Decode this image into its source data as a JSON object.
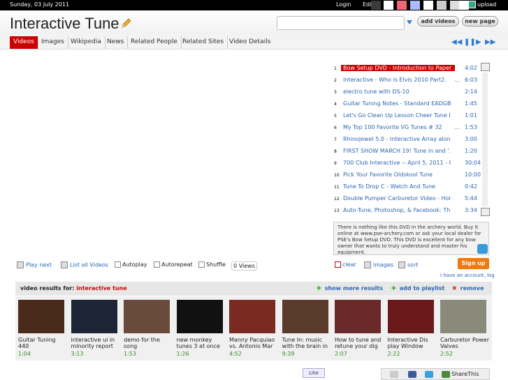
{
  "topbar": {
    "date": "Sunday, 03 July 2011",
    "login": "Login",
    "edit": "Edit",
    "upload": "upload",
    "swatches": [
      "#3b3b3b",
      "#ffffff",
      "#ee6677",
      "#aabbff",
      "#ffffff",
      "#cccccc",
      "#dddddd",
      "#ffffff"
    ]
  },
  "header": {
    "title": "Interactive Tune",
    "add_videos": "add videos",
    "new_page": "new page",
    "search_value": ""
  },
  "tabs": [
    "Videos",
    "Images",
    "Wikipedia",
    "News",
    "Related People",
    "Related Sites",
    "Video Details"
  ],
  "playlist": [
    {
      "n": "1",
      "title": "Bow Setup DVD - Introduction to Paper ...",
      "dots": "",
      "dur": "4:02",
      "selected": true
    },
    {
      "n": "2",
      "title": "Interactive - Who is Elvis 2010 Part2.",
      "dots": "...",
      "dur": "6:03"
    },
    {
      "n": "3",
      "title": "electro tune with DS-10",
      "dots": "",
      "dur": "2:14"
    },
    {
      "n": "4",
      "title": "Guitar Tuning Notes - Standard EADGB...",
      "dots": "",
      "dur": "1:45"
    },
    {
      "n": "5",
      "title": "Let's Go Clean Up Lesson Cheer Tune I...",
      "dots": "",
      "dur": "1:01"
    },
    {
      "n": "6",
      "title": "My Top 100 Favorite VG Tunes # 32",
      "dots": "...",
      "dur": "1:53"
    },
    {
      "n": "7",
      "title": "Rhinojewel 5.0 - Interactive Array along...",
      "dots": "",
      "dur": "3:00"
    },
    {
      "n": "8",
      "title": "FIRST SHOW MARCH 19! Tune in and '...",
      "dots": "",
      "dur": "1:20"
    },
    {
      "n": "9",
      "title": "700 Club Interactive -- April 5, 2011 - CE...",
      "dots": "",
      "dur": "30:04"
    },
    {
      "n": "10",
      "title": "Pick Your Favorite Oldskool Tune",
      "dots": "",
      "dur": "10:00"
    },
    {
      "n": "11",
      "title": "Tune To Drop C - Watch And Tune",
      "dots": "",
      "dur": "0:42"
    },
    {
      "n": "12",
      "title": "Double Pumper Carburetor Video - Holl...",
      "dots": "",
      "dur": "5:44"
    },
    {
      "n": "13",
      "title": "Auto-Tune, Photoshop, & Facebook: Th...",
      "dots": "",
      "dur": "3:34"
    }
  ],
  "description": "There is nothing like this DVD in the archery world. Buy it online at www.pse-archery.com or ask your local dealer for PSE's Bow Setup DVD. This DVD is excellent for any bow owner that wants to truly understand and master his equipment.",
  "controls": {
    "play_next": "Play next",
    "list_all": "List all Videos",
    "autoplay": "Autoplay",
    "autorepeat": "Autorepeat",
    "shuffle": "Shuffle",
    "views": "0 Views",
    "clear": "clear",
    "images": "images",
    "sort": "sort"
  },
  "signup": {
    "label": "Sign up",
    "account": "I have an account, log"
  },
  "results_bar": {
    "label": "video results for:",
    "query": "interactive tune",
    "show_more": "show more results",
    "add_playlist": "add to playlist",
    "remove": "remove"
  },
  "results": [
    {
      "title": "Guitar Tuning 440",
      "dur": "1:04",
      "color": "#4a2a1a"
    },
    {
      "title": "interactive ui in minority report",
      "dur": "3:13",
      "color": "#1c2436"
    },
    {
      "title": "demo for the song",
      "dur": "1:53",
      "color": "#6a4a3a"
    },
    {
      "title": "new monkey tunes 3 at once",
      "dur": "1:26",
      "color": "#111111"
    },
    {
      "title": "Manny Pacquiao vs. Antonio Mar",
      "dur": "4:52",
      "color": "#7a2a20"
    },
    {
      "title": "Tune In: music with the brain in",
      "dur": "9:39",
      "color": "#5a3a2a"
    },
    {
      "title": "How to tune and retune your dig",
      "dur": "2:07",
      "color": "#6a2a2a"
    },
    {
      "title": "Interactive Dis play Window",
      "dur": "2:22",
      "color": "#6a1a1a"
    },
    {
      "title": "Carburetor Power Valves",
      "dur": "2:52",
      "color": "#8a8a7a"
    }
  ],
  "footer": {
    "like": "Like",
    "sharethis": "ShareThis"
  }
}
